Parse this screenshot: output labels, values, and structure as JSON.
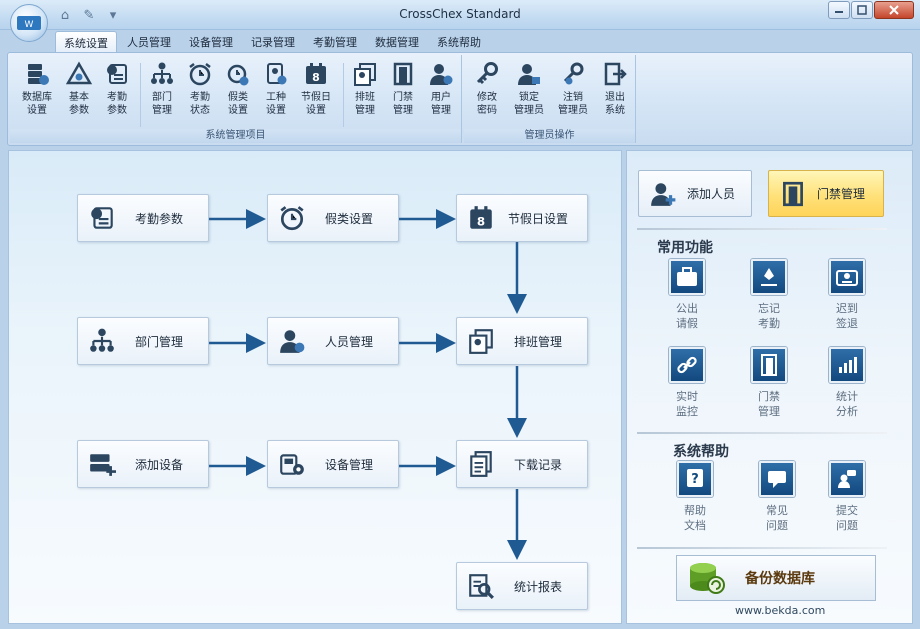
{
  "window": {
    "title": "CrossChex Standard"
  },
  "ribbon": {
    "tabs": [
      "系统设置",
      "人员管理",
      "设备管理",
      "记录管理",
      "考勤管理",
      "数据管理",
      "系统帮助"
    ],
    "groups": [
      {
        "label": "系统管理项目",
        "buttons": [
          "数据库\n设置",
          "基本\n参数",
          "考勤\n参数",
          "部门\n管理",
          "考勤\n状态",
          "假类\n设置",
          "工种\n设置",
          "节假日\n设置",
          "排班\n管理",
          "门禁\n管理",
          "用户\n管理"
        ]
      },
      {
        "label": "管理员操作",
        "buttons": [
          "修改\n密码",
          "锁定\n管理员",
          "注销\n管理员",
          "退出\n系统"
        ]
      }
    ]
  },
  "flow": {
    "attendance_params": "考勤参数",
    "leave_settings": "假类设置",
    "holiday_settings": "节假日设置",
    "department_mgmt": "部门管理",
    "personnel_mgmt": "人员管理",
    "shift_mgmt": "排班管理",
    "add_device": "添加设备",
    "device_mgmt": "设备管理",
    "download_records": "下载记录",
    "statistics_report": "统计报表"
  },
  "side": {
    "add_person": "添加人员",
    "access_control": "门禁管理",
    "common_title": "常用功能",
    "common_items": [
      "公出\n请假",
      "忘记\n考勤",
      "迟到\n签退",
      "实时\n监控",
      "门禁\n管理",
      "统计\n分析"
    ],
    "help_title": "系统帮助",
    "help_items": [
      "帮助\n文档",
      "常见\n问题",
      "提交\n问题"
    ],
    "backup": "备份数据库"
  },
  "watermark": "www.bekda.com"
}
